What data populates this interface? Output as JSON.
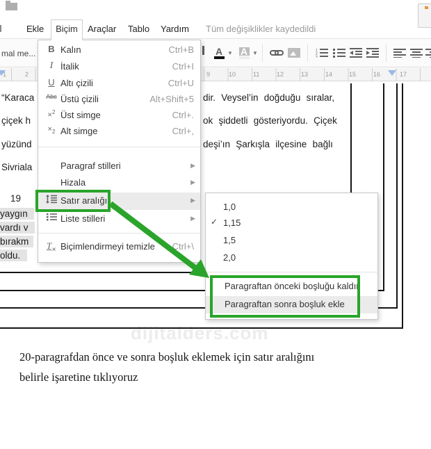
{
  "menubar": {
    "items": [
      "Ekle",
      "Biçim",
      "Araçlar",
      "Tablo",
      "Yardım"
    ],
    "status": "Tüm değişiklikler kaydedildi"
  },
  "toolbar": {
    "style_label": "mal me...",
    "icons": [
      "text-color-icon",
      "highlight-color-icon",
      "link-icon",
      "image-icon",
      "numbered-list-icon",
      "bulleted-list-icon",
      "outdent-icon",
      "indent-icon",
      "align-left-icon",
      "align-center-icon",
      "align-right-icon"
    ],
    "text_color_letter": "A"
  },
  "ruler": {
    "left_numbers": [
      "1",
      "2"
    ],
    "right_numbers": [
      "9",
      "10",
      "11",
      "12",
      "13",
      "14",
      "15",
      "16",
      "17"
    ]
  },
  "format_menu": {
    "items": [
      {
        "label": "Kalın",
        "shortcut": "Ctrl+B"
      },
      {
        "label": "İtalik",
        "shortcut": "Ctrl+I"
      },
      {
        "label": "Altı çizili",
        "shortcut": "Ctrl+U"
      },
      {
        "label": "Üstü çizili",
        "shortcut": "Alt+Shift+5"
      },
      {
        "label": "Üst simge",
        "shortcut": "Ctrl+."
      },
      {
        "label": "Alt simge",
        "shortcut": "Ctrl+,"
      },
      {
        "label": "Paragraf stilleri",
        "submenu": true
      },
      {
        "label": "Hizala",
        "submenu": true
      },
      {
        "label": "Satır aralığı",
        "submenu": true,
        "highlighted": true
      },
      {
        "label": "Liste stilleri",
        "submenu": true
      },
      {
        "label": "Biçimlendirmeyi temizle",
        "shortcut": "Ctrl+\\"
      }
    ],
    "strike_icon_text": "Abc"
  },
  "spacing_submenu": {
    "options": [
      {
        "label": "1,0"
      },
      {
        "label": "1,15",
        "checked": true,
        "checkmark": "✓"
      },
      {
        "label": "1,5"
      },
      {
        "label": "2,0"
      }
    ],
    "actions": [
      {
        "label": "Paragraftan önceki boşluğu kaldır"
      },
      {
        "label": "Paragraftan sonra boşluk ekle",
        "hovered": true
      }
    ]
  },
  "document": {
    "lines_left": [
      "“Karaca",
      "çiçek  h",
      "yüzünd",
      "Sivriala",
      "19"
    ],
    "lines_right": [
      "dir.  Veysel’in  doğduğu  sıralar,",
      "ok  şiddetli  gösteriyordu.  Çiçek",
      "deşi’ın  Şarkışla  ilçesine  bağlı"
    ],
    "selected_lines": [
      "yaygın",
      "vardı  v",
      "bırakm",
      "oldu."
    ],
    "watermark": "dijitalders.com"
  },
  "caption": {
    "line1": "20-paragrafdan önce ve sonra boşluk eklemek için satır aralığını",
    "line2": "belirle işaretine tıklıyoruz"
  },
  "colors": {
    "annotation_green": "#2aa42a",
    "selection_gray": "#e3e3e3"
  }
}
